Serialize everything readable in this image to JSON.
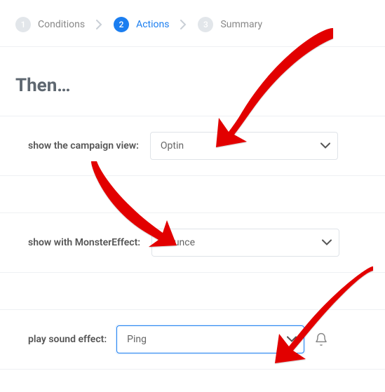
{
  "stepper": {
    "steps": [
      {
        "num": "1",
        "label": "Conditions"
      },
      {
        "num": "2",
        "label": "Actions"
      },
      {
        "num": "3",
        "label": "Summary"
      }
    ]
  },
  "heading": "Then…",
  "rows": {
    "campaign_view": {
      "label": "show the campaign view:",
      "value": "Optin"
    },
    "monster_effect": {
      "label": "show with MonsterEffect:",
      "value": "Bounce"
    },
    "sound_effect": {
      "label": "play sound effect:",
      "value": "Ping"
    }
  }
}
